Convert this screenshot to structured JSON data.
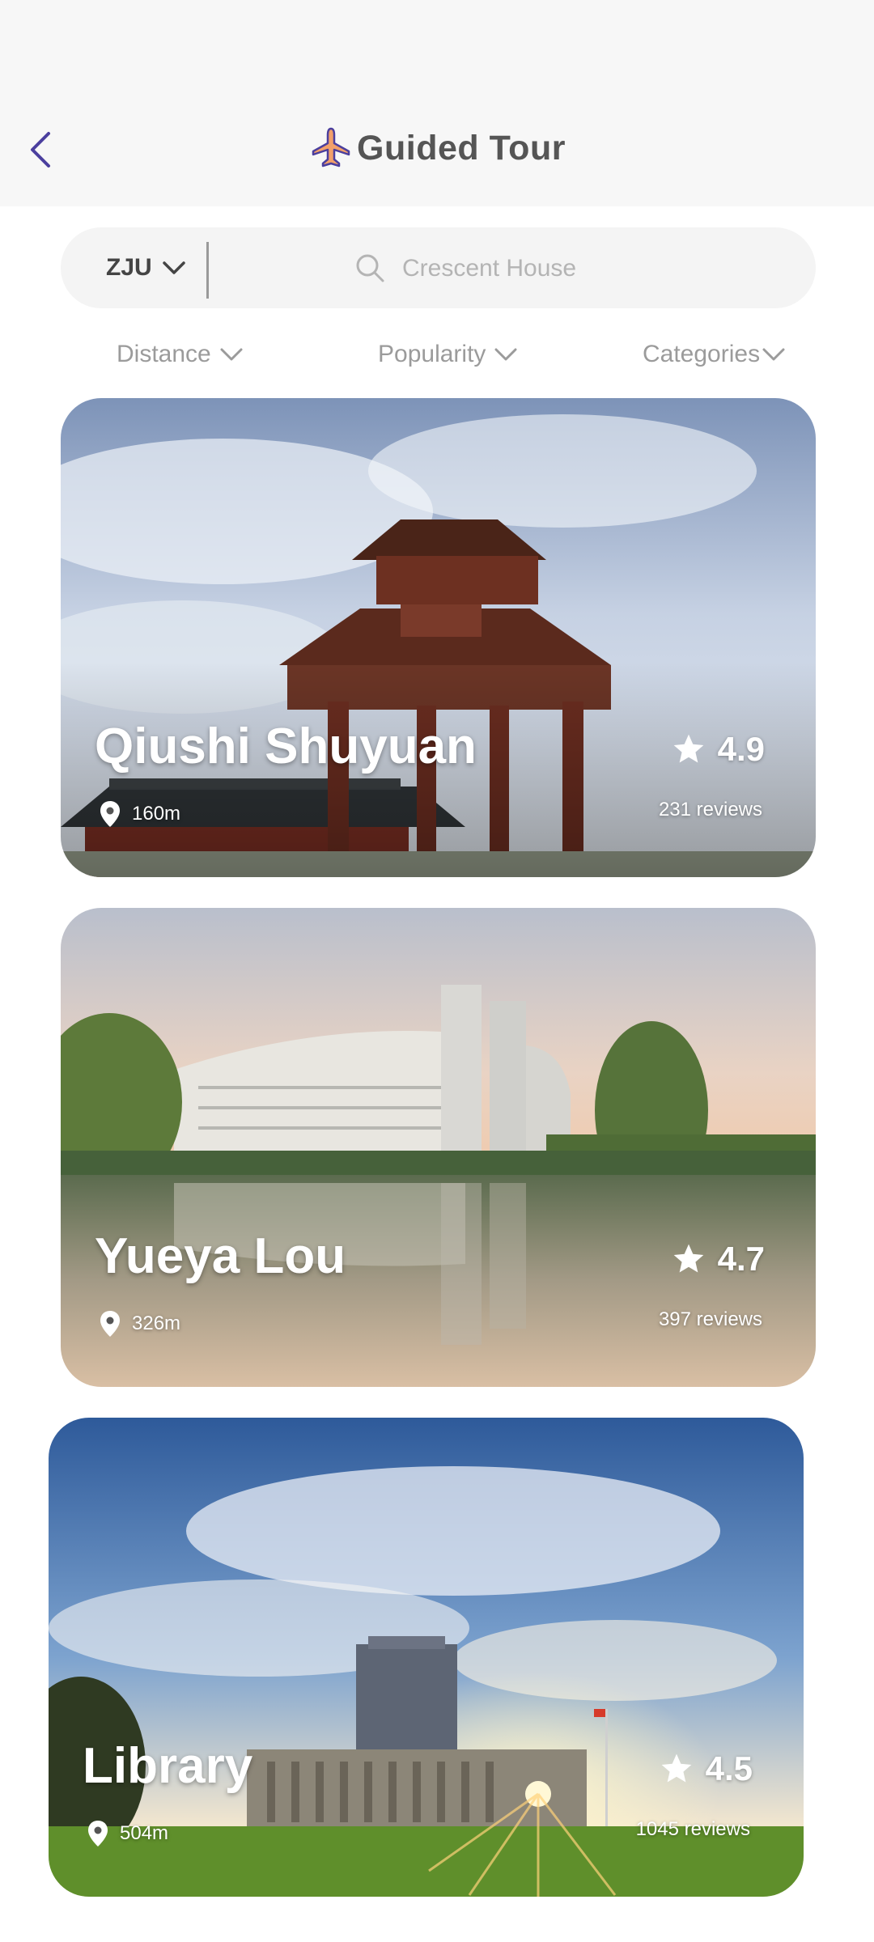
{
  "header": {
    "title": "Guided Tour",
    "back_icon": "chevron-left-icon",
    "logo_icon": "airplane-icon",
    "accent_color": "#4b3f9e",
    "logo_color": "#f2a06a"
  },
  "search": {
    "city": "ZJU",
    "placeholder": "Crescent House"
  },
  "filters": [
    {
      "label": "Distance"
    },
    {
      "label": "Popularity"
    },
    {
      "label": "Categories"
    }
  ],
  "places": [
    {
      "name": "Qiushi Shuyuan",
      "distance": "160m",
      "rating": "4.9",
      "reviews": "231 reviews"
    },
    {
      "name": "Yueya Lou",
      "distance": "326m",
      "rating": "4.7",
      "reviews": "397 reviews"
    },
    {
      "name": "Library",
      "distance": "504m",
      "rating": "4.5",
      "reviews": "1045 reviews"
    }
  ]
}
